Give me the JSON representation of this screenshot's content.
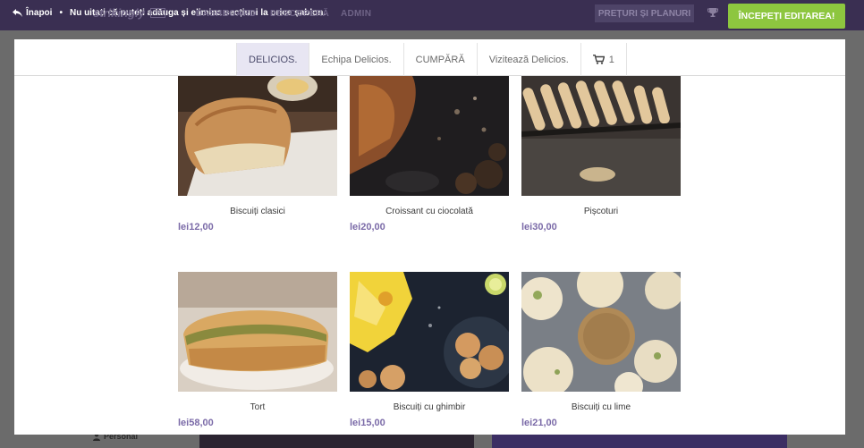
{
  "topbar": {
    "back_label": "Înapoi",
    "separator": "•",
    "hint": "Nu uitați că puteți adăuga și elimina secțiuni la orice șablon.",
    "logo": "strikingly",
    "vip": "VIP",
    "nav": [
      "DASHBOARD",
      "DESCOPERĂ",
      "ADMIN"
    ],
    "pricing_label": "PREȚURI ȘI PLANURI",
    "start_label": "ÎNCEPEȚI EDITAREA!",
    "start_color": "#8dc63f",
    "bar_color": "#3a2f52"
  },
  "site": {
    "nav": {
      "tabs": [
        "DELICIOS.",
        "Echipa Delicios.",
        "CUMPĂRĂ",
        "Vizitează Delicios."
      ],
      "active_tab": "DELICIOS.",
      "cart_count": "1",
      "cart_icon": "cart-icon"
    },
    "products": [
      {
        "name": "Biscuiți clasici",
        "price": "lei12,00"
      },
      {
        "name": "Croissant cu ciocolată",
        "price": "lei20,00"
      },
      {
        "name": "Pișcoturi",
        "price": "lei30,00"
      },
      {
        "name": "Tort",
        "price": "lei58,00"
      },
      {
        "name": "Biscuiți cu ghimbir",
        "price": "lei15,00"
      },
      {
        "name": "Biscuiți cu lime",
        "price": "lei21,00"
      }
    ],
    "price_color": "#7b6ba8"
  },
  "background": {
    "personal_label": "Personal"
  }
}
